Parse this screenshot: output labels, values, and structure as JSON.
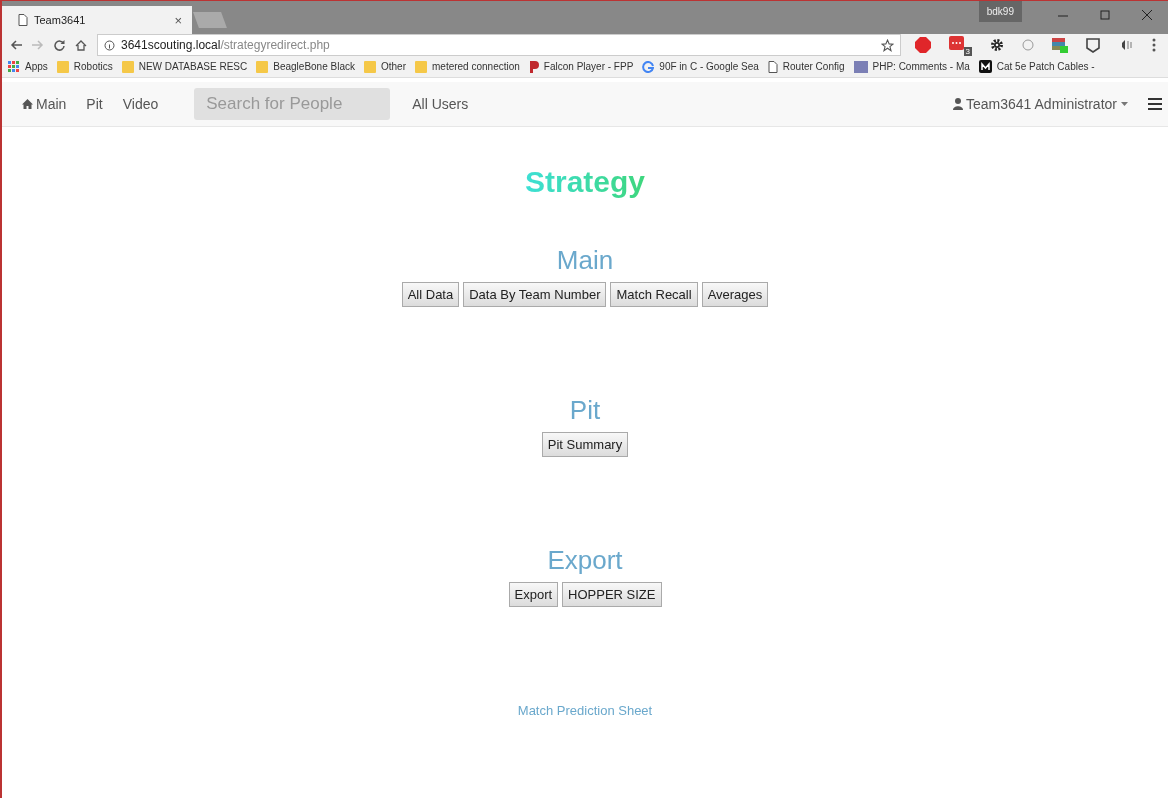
{
  "browser": {
    "tabs": [
      {
        "title": "Team3641",
        "close": "×",
        "selected": true
      }
    ],
    "profile": "bdk99",
    "url": {
      "host": "3641scouting.local",
      "path": "/strategyredirect.php"
    },
    "bookmarks": [
      {
        "kind": "apps",
        "label": "Apps"
      },
      {
        "kind": "folder",
        "label": "Robotics"
      },
      {
        "kind": "folder",
        "label": "NEW DATABASE RESC"
      },
      {
        "kind": "folder",
        "label": "BeagleBone Black"
      },
      {
        "kind": "folder",
        "label": "Other"
      },
      {
        "kind": "folder",
        "label": "metered connection"
      },
      {
        "kind": "falcon",
        "label": "Falcon Player - FPP"
      },
      {
        "kind": "google",
        "label": "90F in C - Google Sea"
      },
      {
        "kind": "page",
        "label": "Router Config"
      },
      {
        "kind": "php",
        "label": "PHP: Comments - Ma"
      },
      {
        "kind": "m",
        "label": "Cat 5e Patch Cables -"
      }
    ],
    "extensions": [
      {
        "kind": "abp"
      },
      {
        "kind": "red",
        "badge": "3"
      },
      {
        "kind": "gear"
      },
      {
        "kind": "circle"
      },
      {
        "kind": "stack"
      },
      {
        "kind": "shield"
      },
      {
        "kind": "speaker"
      }
    ]
  },
  "navbar": {
    "items": [
      {
        "label": "Main",
        "kind": "home"
      },
      {
        "label": "Pit",
        "kind": "plain"
      },
      {
        "label": "Video",
        "kind": "plain"
      }
    ],
    "search": {
      "placeholder": "Search for People"
    },
    "after": [
      {
        "label": "All Users"
      }
    ],
    "user": "Team3641 Administrator"
  },
  "title": "Strategy",
  "sections": [
    {
      "heading": "Main",
      "buttons": [
        "All Data",
        "Data By Team Number",
        "Match Recall",
        "Averages"
      ]
    },
    {
      "heading": "Pit",
      "buttons": [
        "Pit Summary"
      ]
    },
    {
      "heading": "Export",
      "buttons": [
        "Export",
        "HOPPER SIZE"
      ]
    }
  ],
  "link": "Match Prediction Sheet"
}
